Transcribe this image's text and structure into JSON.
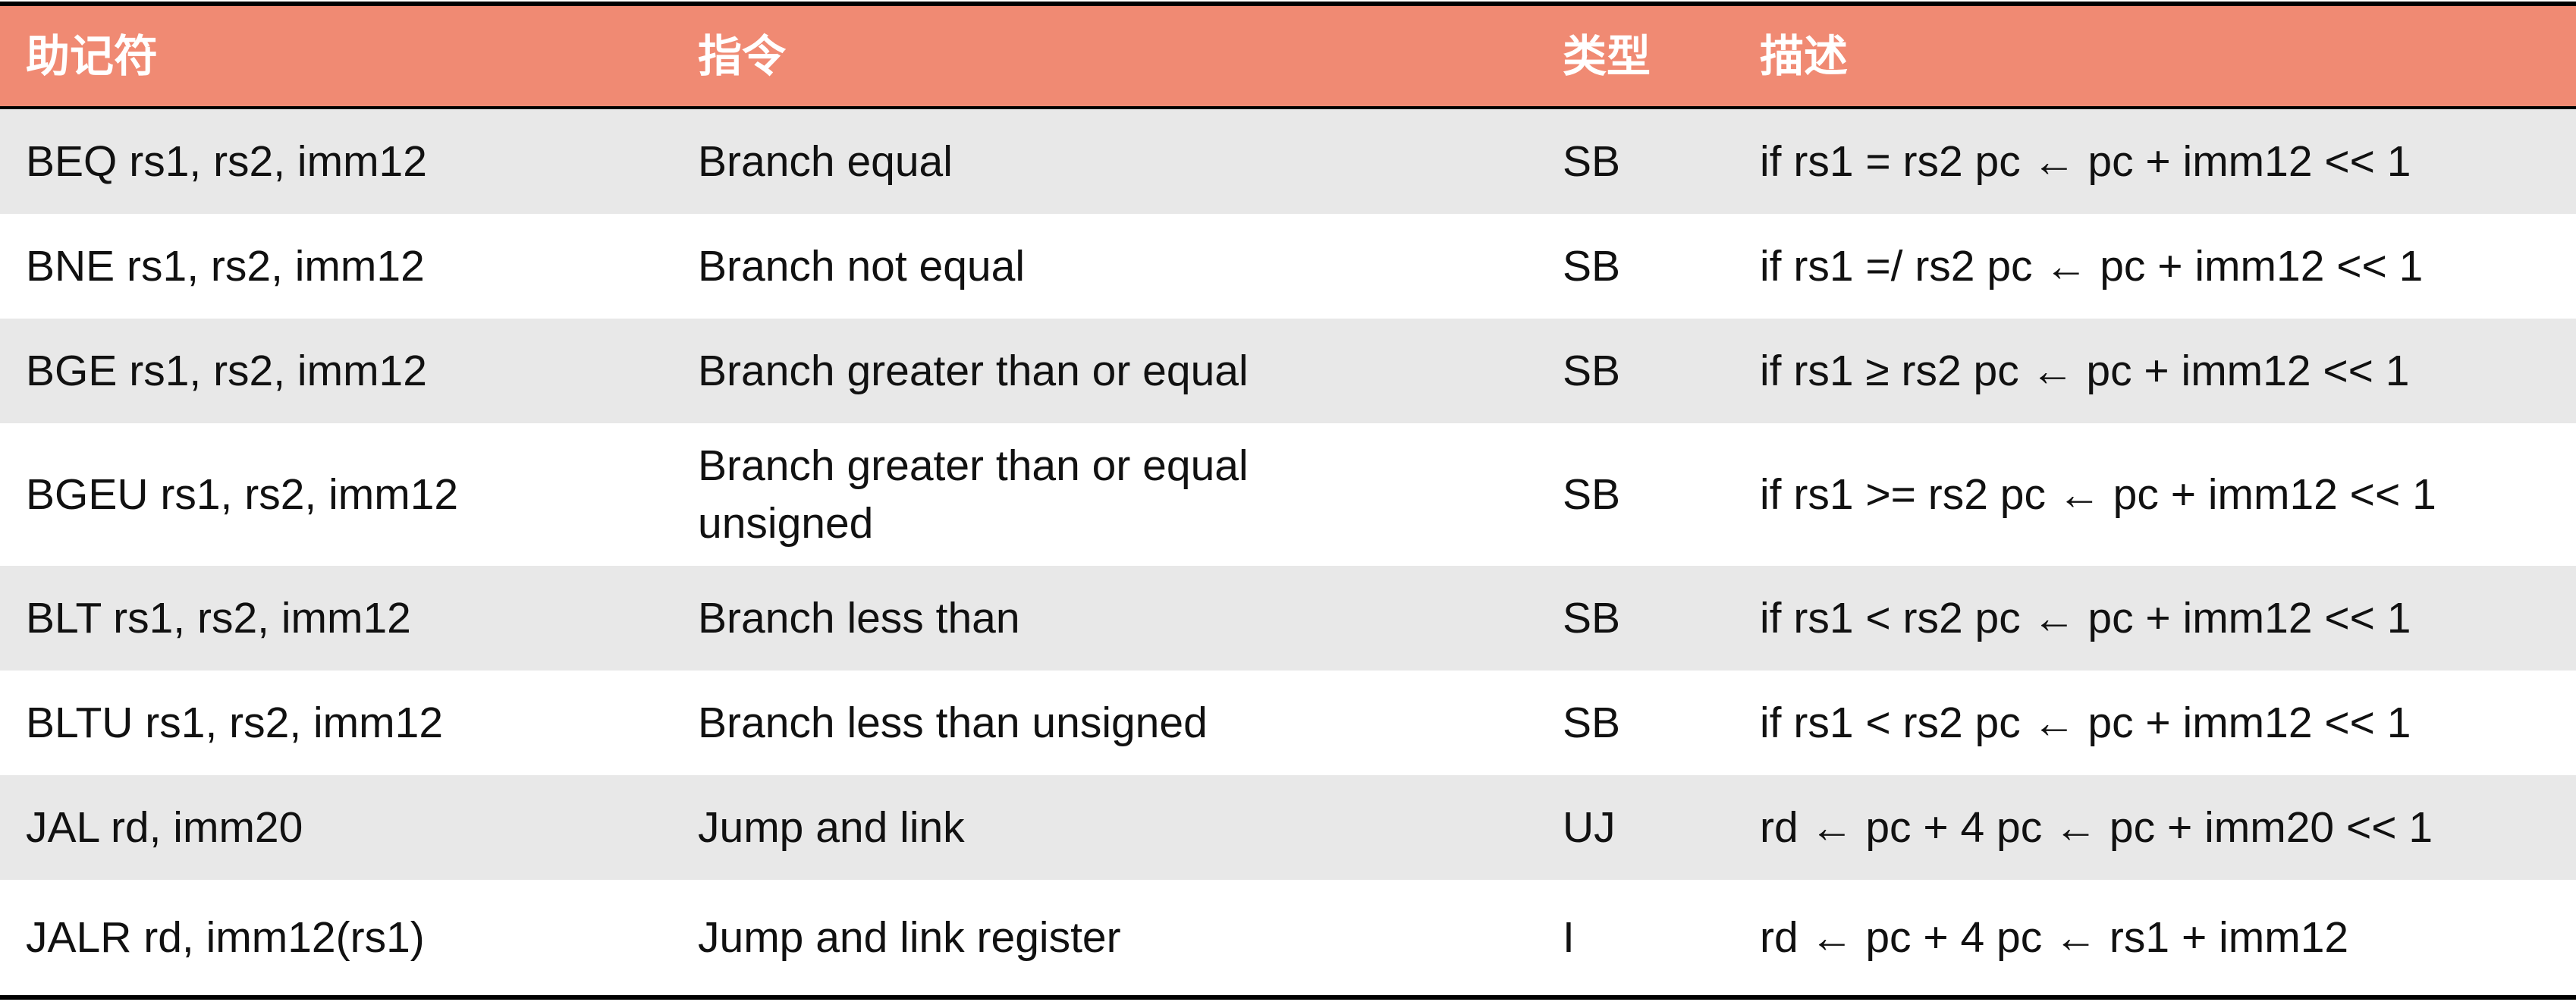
{
  "table": {
    "headers": [
      "助记符",
      "指令",
      "类型",
      "描述"
    ],
    "rows": [
      {
        "mnemonic": "BEQ rs1, rs2, imm12",
        "instruction": "Branch equal",
        "type": "SB",
        "description": "if rs1 = rs2 pc ← pc + imm12 << 1"
      },
      {
        "mnemonic": "BNE rs1, rs2, imm12",
        "instruction": "Branch not equal",
        "type": "SB",
        "description": "if rs1 =/ rs2 pc ← pc + imm12 << 1"
      },
      {
        "mnemonic": "BGE rs1, rs2, imm12",
        "instruction": "Branch greater than or equal",
        "type": "SB",
        "description": "if rs1 ≥ rs2 pc ← pc + imm12 << 1"
      },
      {
        "mnemonic": "BGEU rs1, rs2, imm12",
        "instruction": "Branch greater than or equal\nunsigned",
        "type": "SB",
        "description": "if rs1 >= rs2 pc ← pc + imm12 << 1"
      },
      {
        "mnemonic": "BLT rs1, rs2, imm12",
        "instruction": "Branch less than",
        "type": "SB",
        "description": "if rs1 < rs2 pc ← pc + imm12 << 1"
      },
      {
        "mnemonic": "BLTU rs1, rs2, imm12",
        "instruction": "Branch less than unsigned",
        "type": "SB",
        "description": "if rs1 < rs2 pc ← pc + imm12 << 1"
      },
      {
        "mnemonic": "JAL rd, imm20",
        "instruction": "Jump and link",
        "type": "UJ",
        "description": "rd ← pc + 4 pc ← pc + imm20 << 1"
      },
      {
        "mnemonic": "JALR rd, imm12(rs1)",
        "instruction": "Jump and link register",
        "type": "I",
        "description": "rd ← pc + 4 pc ← rs1 + imm12"
      }
    ]
  },
  "colors": {
    "header_bg": "#F08A73",
    "header_text": "#FFFFFF",
    "row_shaded": "#E8E8E8",
    "row_plain": "#FFFFFF",
    "rule": "#000000"
  }
}
